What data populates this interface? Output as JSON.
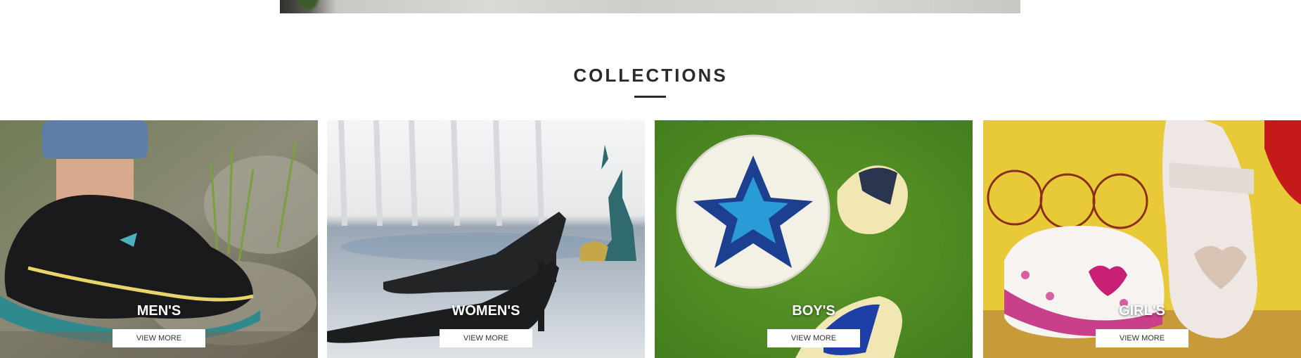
{
  "section": {
    "title": "COLLECTIONS"
  },
  "collections": [
    {
      "label": "MEN'S",
      "button": "VIEW MORE"
    },
    {
      "label": "WOMEN'S",
      "button": "VIEW MORE"
    },
    {
      "label": "BOY'S",
      "button": "VIEW MORE"
    },
    {
      "label": "GIRL'S",
      "button": "VIEW MORE"
    }
  ]
}
